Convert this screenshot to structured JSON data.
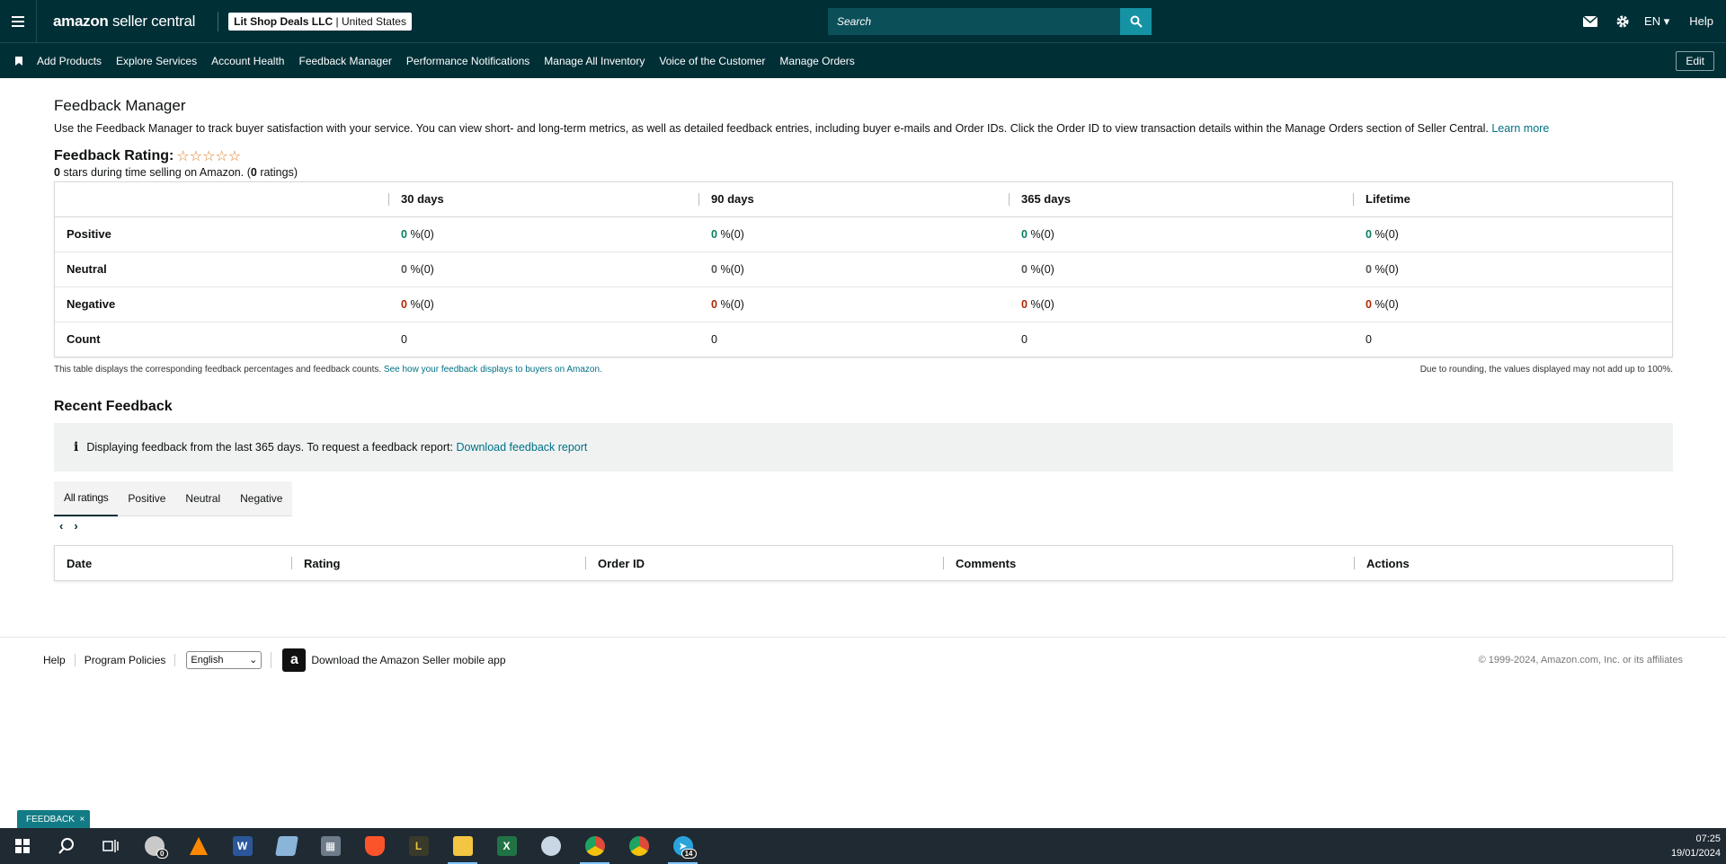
{
  "header": {
    "logo_main": "amazon",
    "logo_sub": "seller central",
    "account_name": "Lit Shop Deals LLC",
    "account_region": "United States",
    "search_placeholder": "Search",
    "language": "EN",
    "help": "Help"
  },
  "nav": {
    "items": [
      "Add Products",
      "Explore Services",
      "Account Health",
      "Feedback Manager",
      "Performance Notifications",
      "Manage All Inventory",
      "Voice of the Customer",
      "Manage Orders"
    ],
    "edit": "Edit"
  },
  "page": {
    "title": "Feedback Manager",
    "intro": "Use the Feedback Manager to track buyer satisfaction with your service. You can view short- and long-term metrics, as well as detailed feedback entries, including buyer e-mails and Order IDs. Click the Order ID to view transaction details within the Manage Orders section of Seller Central.",
    "learn_more": "Learn more",
    "rating_label": "Feedback Rating:",
    "stars": "☆☆☆☆☆",
    "stars_count": "0",
    "stars_text": "stars during time selling on Amazon. (",
    "ratings_count": "0",
    "ratings_text": "ratings)"
  },
  "metrics": {
    "columns": [
      "30 days",
      "90 days",
      "365 days",
      "Lifetime"
    ],
    "rows": [
      {
        "label": "Positive",
        "values": [
          "0",
          "0",
          "0",
          "0"
        ],
        "suffix": "%(0)",
        "color": "#067d62"
      },
      {
        "label": "Neutral",
        "values": [
          "0",
          "0",
          "0",
          "0"
        ],
        "suffix": "%(0)",
        "color": "#565959"
      },
      {
        "label": "Negative",
        "values": [
          "0",
          "0",
          "0",
          "0"
        ],
        "suffix": "%(0)",
        "color": "#b12704"
      },
      {
        "label": "Count",
        "values": [
          "0",
          "0",
          "0",
          "0"
        ],
        "suffix": "",
        "color": "#0f1111"
      }
    ],
    "footnote_left": "This table displays the corresponding feedback percentages and feedback counts.",
    "footnote_link": "See how your feedback displays to buyers on Amazon.",
    "footnote_right": "Due to rounding, the values displayed may not add up to 100%."
  },
  "recent": {
    "title": "Recent Feedback",
    "info_icon": "i",
    "info_text": "Displaying feedback from the last 365 days. To request a feedback report:",
    "info_link": "Download feedback report",
    "tabs": [
      "All ratings",
      "Positive",
      "Neutral",
      "Negative"
    ],
    "pager_prev": "‹",
    "pager_next": "›",
    "columns": [
      "Date",
      "Rating",
      "Order ID",
      "Comments",
      "Actions"
    ]
  },
  "footer": {
    "help": "Help",
    "policies": "Program Policies",
    "language": "English",
    "app_icon": "a",
    "app_text": "Download the Amazon Seller mobile app",
    "copyright": "© 1999-2024, Amazon.com, Inc. or its affiliates"
  },
  "feedback_tag": {
    "label": "FEEDBACK",
    "close": "×"
  },
  "taskbar": {
    "time": "07:25",
    "date": "19/01/2024",
    "items": [
      {
        "name": "start-icon",
        "color": "#1f2a33"
      },
      {
        "name": "search-icon",
        "color": "#1f2a33"
      },
      {
        "name": "task-view-icon",
        "color": "#1f2a33"
      },
      {
        "name": "clock-app-icon",
        "color": "#c9c9c9",
        "badge": "0"
      },
      {
        "name": "vlc-icon",
        "color": "#ff8800"
      },
      {
        "name": "word-icon",
        "color": "#2b579a"
      },
      {
        "name": "notes-icon",
        "color": "#8bb4d9"
      },
      {
        "name": "calculator-icon",
        "color": "#6d7b8a"
      },
      {
        "name": "brave-icon",
        "color": "#fb542b"
      },
      {
        "name": "app-icon",
        "color": "#3a3a2a"
      },
      {
        "name": "file-explorer-icon",
        "color": "#f4c542"
      },
      {
        "name": "excel-icon",
        "color": "#217346"
      },
      {
        "name": "paint-icon",
        "color": "#c9d6e3"
      },
      {
        "name": "chrome-icon",
        "color": "#dd4b39"
      },
      {
        "name": "chrome-profile-icon",
        "color": "#dd4b39"
      },
      {
        "name": "telegram-icon",
        "color": "#2aa3dd",
        "badge": "14"
      }
    ]
  }
}
